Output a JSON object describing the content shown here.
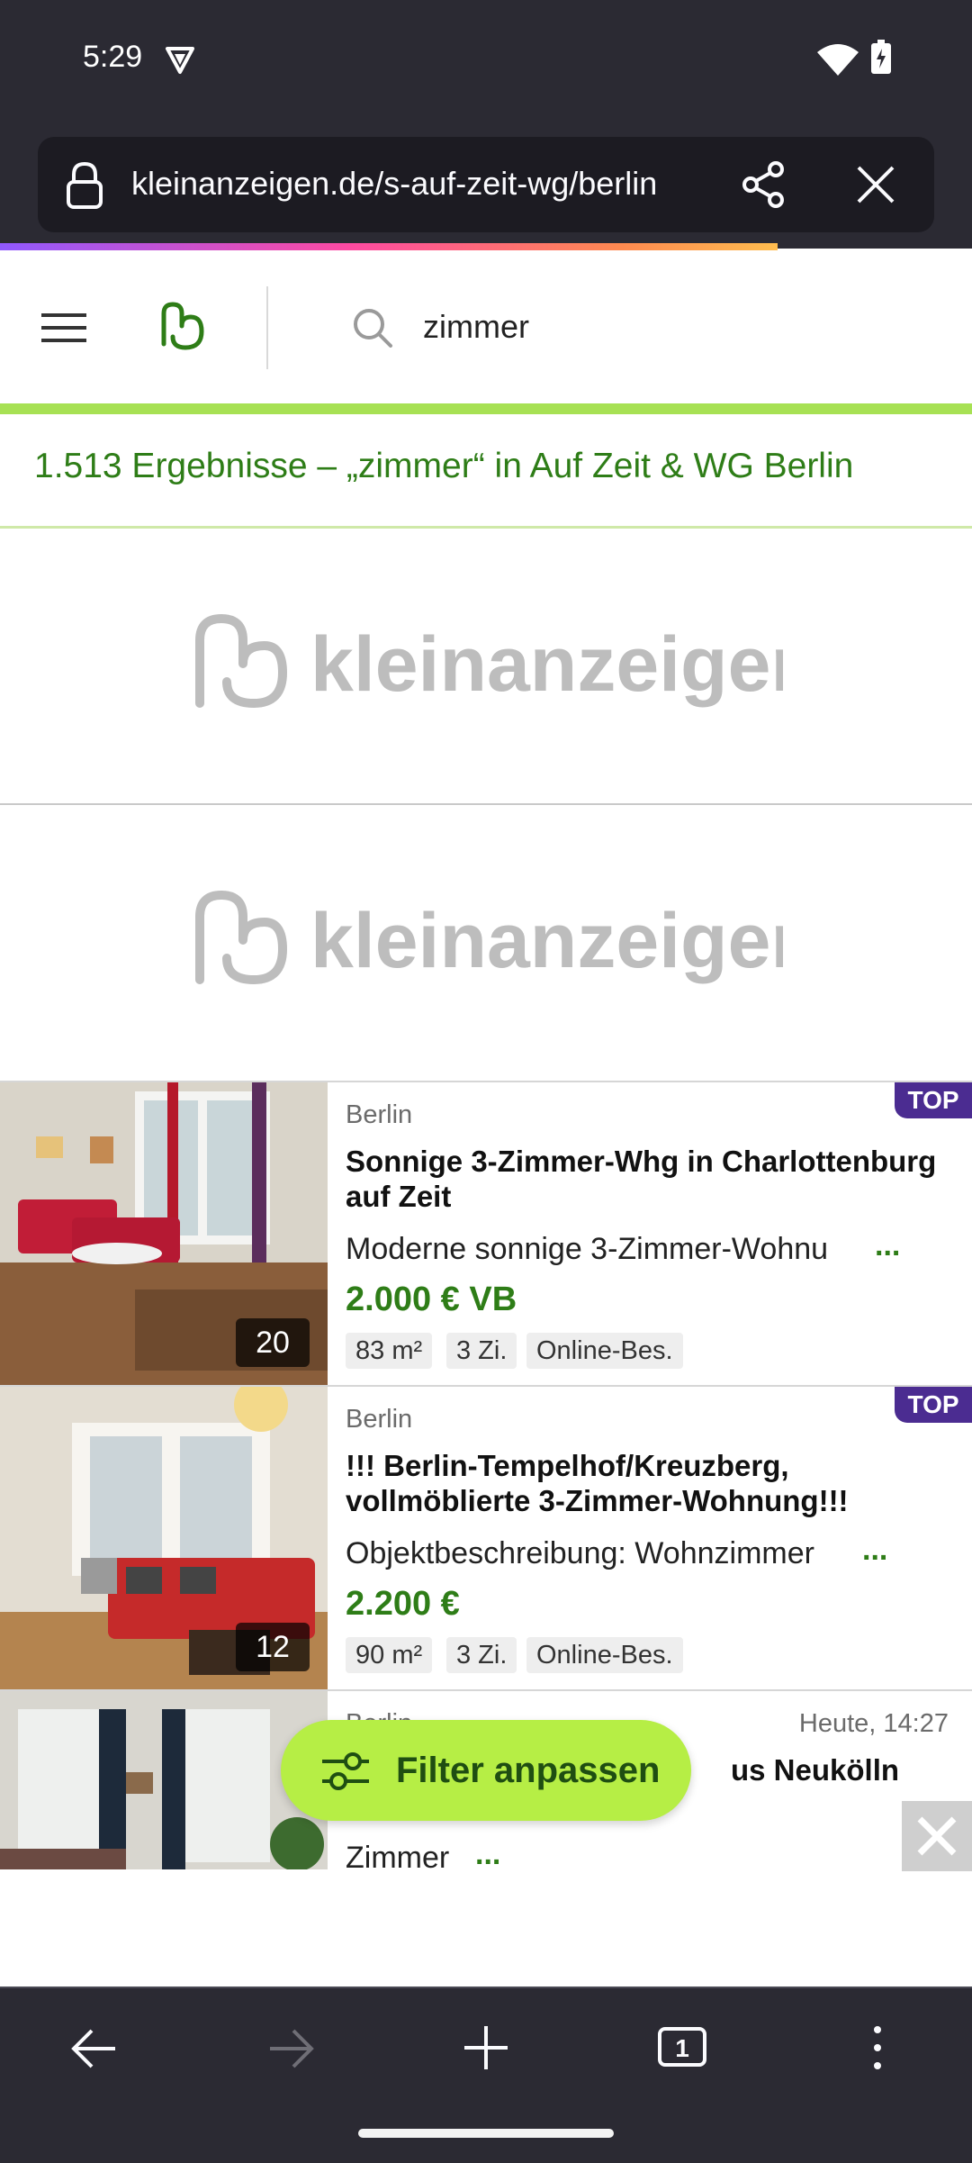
{
  "status_bar": {
    "time": "5:29"
  },
  "browser": {
    "url": "kleinanzeigen.de/s-auf-zeit-wg/berlin",
    "icons": [
      "lock-icon",
      "share-icon",
      "close-icon",
      "back-icon",
      "forward-icon",
      "new-tab-icon",
      "tab-counter-icon",
      "overflow-menu-icon"
    ],
    "tab_count": "1"
  },
  "site_header": {
    "search_query": "zimmer"
  },
  "results_heading": "1.513 Ergebnisse – „zimmer“ in Auf Zeit & WG Berlin",
  "ads": [
    {
      "brand": "kleinanzeigen"
    },
    {
      "brand": "kleinanzeigen"
    }
  ],
  "listings": [
    {
      "location": "Berlin",
      "title": "Sonnige 3-Zimmer-Whg in Charlottenburg auf Zeit",
      "description": "Moderne sonnige 3-Zimmer-Wohnu",
      "ellipsis": "...",
      "price": "2.000 € VB",
      "tags": [
        "83 m²",
        "3 Zi.",
        "Online-Bes."
      ],
      "image_count": "20",
      "badge": "TOP"
    },
    {
      "location": "Berlin",
      "title": "!!! Berlin-Tempelhof/Kreuzberg, vollmöblierte 3-Zimmer-Wohnung!!!",
      "description": "Objektbeschreibung: Wohnzimmer",
      "ellipsis": "...",
      "price": "2.200 €",
      "tags": [
        "90 m²",
        "3 Zi.",
        "Online-Bes."
      ],
      "image_count": "12",
      "badge": "TOP"
    },
    {
      "location": "Berlin",
      "date": "Heute, 14:27",
      "title_partial": "us Neukölln",
      "description": "Zimmer",
      "ellipsis": "..."
    }
  ],
  "filter_button": {
    "label": "Filter anpassen"
  },
  "colors": {
    "brand_green": "#2e7d17",
    "accent_lime": "#b6ee45",
    "top_badge": "#4b2c91",
    "browser_chrome": "#2b2a33"
  }
}
